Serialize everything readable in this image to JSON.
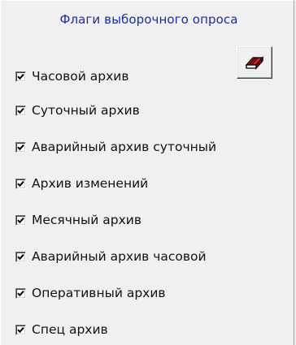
{
  "panel": {
    "title": "Флаги выборочного опроса",
    "clear_button_icon": "eraser-icon",
    "checkmark_icon": "checkmark-icon",
    "flags": [
      {
        "label": "Часовой архив",
        "checked": true
      },
      {
        "label": "Суточный архив",
        "checked": true
      },
      {
        "label": "Аварийный архив суточный",
        "checked": true
      },
      {
        "label": "Архив изменений",
        "checked": true
      },
      {
        "label": "Месячный архив",
        "checked": true
      },
      {
        "label": "Аварийный архив часовой",
        "checked": true
      },
      {
        "label": "Оперативный архив",
        "checked": true
      },
      {
        "label": "Спец архив",
        "checked": true
      }
    ]
  }
}
